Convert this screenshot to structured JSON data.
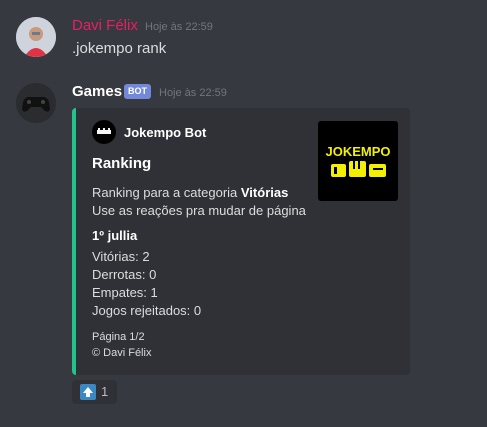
{
  "messages": [
    {
      "username": "Davi Félix",
      "timestamp": "Hoje às 22:59",
      "content": ".jokempo rank",
      "username_color": "#e91e63"
    },
    {
      "username": "Games",
      "badge": "BOT",
      "timestamp": "Hoje às 22:59",
      "embed": {
        "author": "Jokempo Bot",
        "title": "Ranking",
        "description_prefix": "Ranking para a categoria ",
        "description_bold": "Vitórias",
        "description_line2": "Use as reações pra mudar de página",
        "field_name": "1º jullia",
        "field_lines": [
          "Vitórias: 2",
          "Derrotas: 0",
          "Empates: 1",
          "Jogos rejeitados: 0"
        ],
        "footer_line1": "Página 1/2",
        "footer_line2": "© Davi Félix",
        "thumbnail_text": "JOKEMPO",
        "accent_color": "#23c48b"
      },
      "reaction": {
        "emoji": "up-arrow-button",
        "count": "1"
      }
    }
  ]
}
